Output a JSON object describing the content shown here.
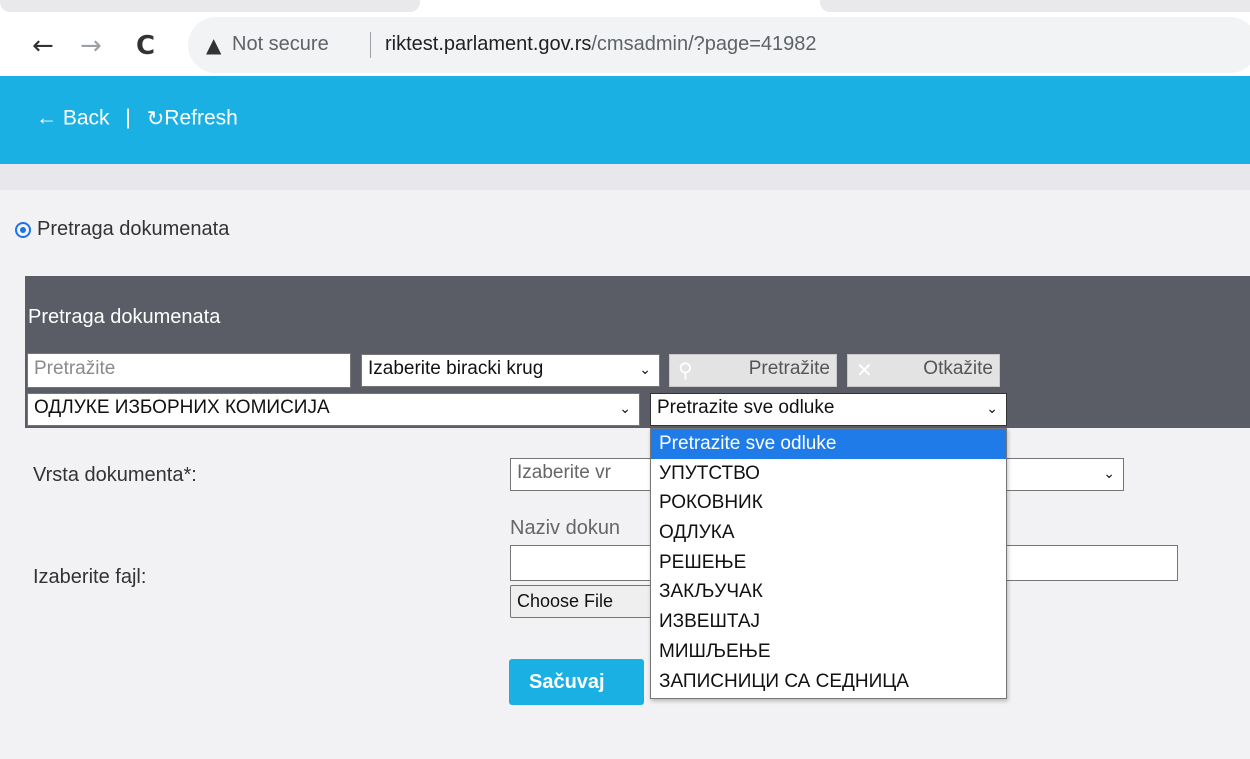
{
  "browser": {
    "back_icon": "←",
    "forward_icon": "→",
    "reload_icon": "C",
    "warning_icon": "▲",
    "not_secure": "Not secure",
    "url_host": "riktest.parlament.gov.rs",
    "url_path": "/cmsadmin/?page=41982"
  },
  "appbar": {
    "back_label": "← Back",
    "separator": "|",
    "refresh_icon": "↻",
    "refresh_label": "Refresh",
    "color": "#1ab0e3"
  },
  "mode": {
    "radio_label": "Pretraga dokumenata",
    "selected": true
  },
  "search_panel": {
    "title": "Pretraga dokumenata",
    "search_placeholder": "Pretražite",
    "district_select": "Izaberite biracki krug",
    "search_button": "Pretražite",
    "cancel_button": "Otkažite",
    "category_select": "ОДЛУКЕ ИЗБОРНИХ КОМИСИЈА",
    "decision_select": "Pretrazite sve odluke"
  },
  "form": {
    "doc_type_label": "Vrsta dokumenta*:",
    "doc_type_select": "Izaberite vr",
    "doc_name_label": "Naziv dokun",
    "file_label": "Izaberite fajl:",
    "choose_file": "Choose File",
    "save_button": "Sačuvaj"
  },
  "dropdown": {
    "options": [
      "Pretrazite sve odluke",
      "УПУТСТВО",
      "РОКОВНИК",
      "ОДЛУКА",
      "РЕШЕЊЕ",
      "ЗАКЉУЧАК",
      "ИЗВЕШТАЈ",
      "МИШЉЕЊЕ",
      "ЗАПИСНИЦИ СА СЕДНИЦА"
    ],
    "selected_index": 0,
    "highlight_color": "#1e7be8"
  }
}
